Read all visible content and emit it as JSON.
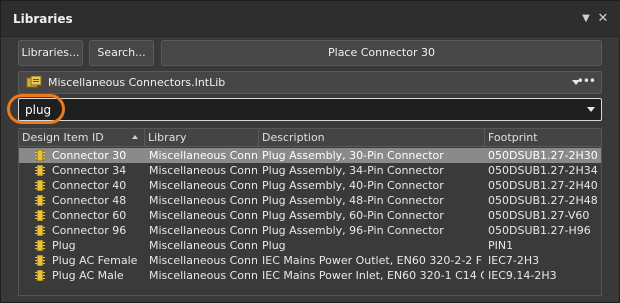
{
  "panel": {
    "title": "Libraries",
    "header_icons": [
      "pin-icon",
      "close-icon"
    ]
  },
  "toolbar": {
    "libraries_label": "Libraries...",
    "search_label": "Search...",
    "place_label": "Place Connector 30"
  },
  "library_selector": {
    "value": "Miscellaneous Connectors.IntLib",
    "icon": "library-icon"
  },
  "filter": {
    "value": "plug"
  },
  "colors": {
    "highlight": "#ee7a19",
    "component_icon": "#e8c23a",
    "selected_row": "#8a8a8a"
  },
  "table": {
    "columns": [
      "Design Item ID",
      "Library",
      "Description",
      "Footprint"
    ],
    "rows": [
      {
        "id": "Connector 30",
        "library": "Miscellaneous Conne",
        "description": "Plug Assembly, 30-Pin Connector",
        "footprint": "050DSUB1.27-2H30",
        "selected": true
      },
      {
        "id": "Connector 34",
        "library": "Miscellaneous Conne",
        "description": "Plug Assembly, 34-Pin Connector",
        "footprint": "050DSUB1.27-2H34"
      },
      {
        "id": "Connector 40",
        "library": "Miscellaneous Conne",
        "description": "Plug Assembly, 40-Pin Connector",
        "footprint": "050DSUB1.27-2H40"
      },
      {
        "id": "Connector 48",
        "library": "Miscellaneous Conne",
        "description": "Plug Assembly, 48-Pin Connector",
        "footprint": "050DSUB1.27-2H48"
      },
      {
        "id": "Connector 60",
        "library": "Miscellaneous Conne",
        "description": "Plug Assembly, 60-Pin Connector",
        "footprint": "050DSUB1.27-V60"
      },
      {
        "id": "Connector 96",
        "library": "Miscellaneous Conne",
        "description": "Plug Assembly, 96-Pin Connector",
        "footprint": "050DSUB1.27-H96"
      },
      {
        "id": "Plug",
        "library": "Miscellaneous Conne",
        "description": "Plug",
        "footprint": "PIN1"
      },
      {
        "id": "Plug AC Female",
        "library": "Miscellaneous Conne",
        "description": "IEC Mains Power Outlet, EN60 320-2-2 F Clas",
        "footprint": "IEC7-2H3"
      },
      {
        "id": "Plug AC Male",
        "library": "Miscellaneous Conne",
        "description": "IEC Mains Power Inlet, EN60 320-1 C14 Class",
        "footprint": "IEC9.14-2H3"
      }
    ]
  }
}
